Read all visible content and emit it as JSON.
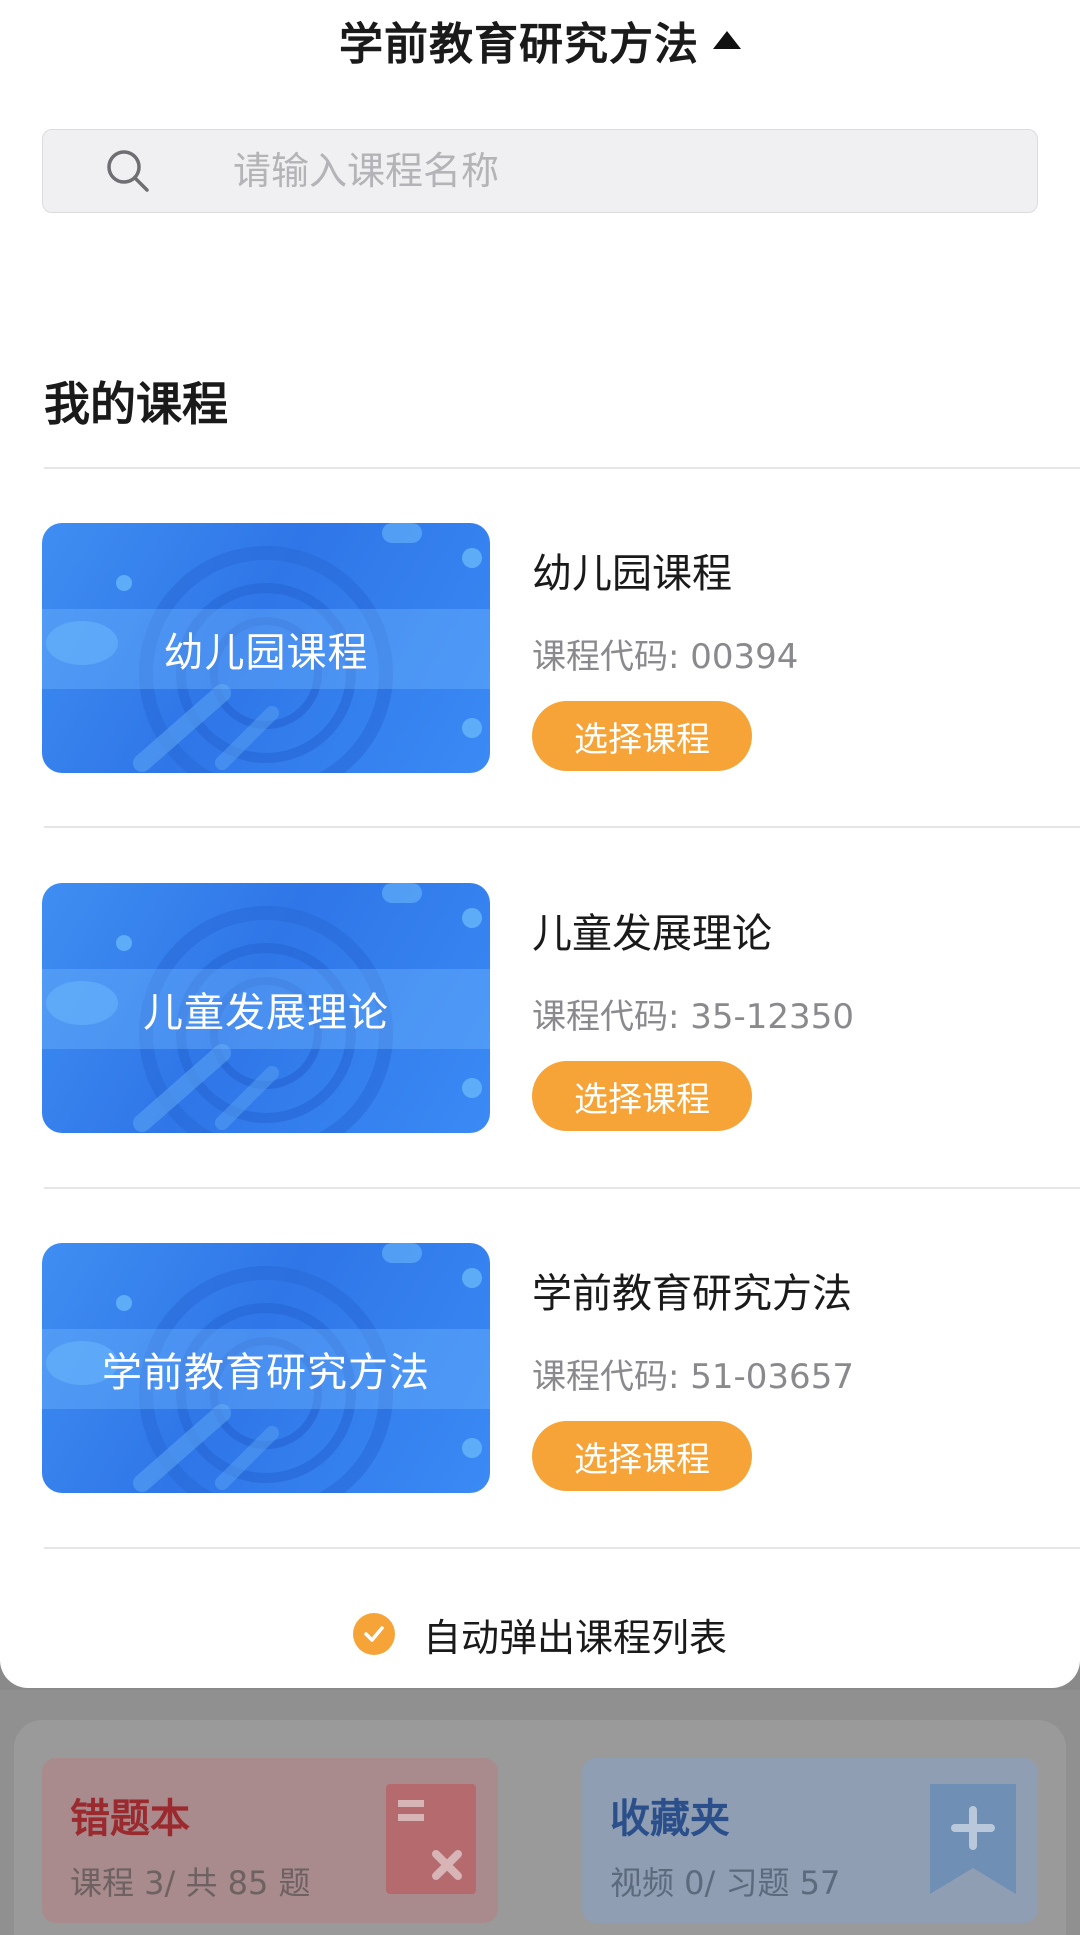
{
  "header": {
    "title": "学前教育研究方法"
  },
  "search": {
    "placeholder": "请输入课程名称",
    "value": ""
  },
  "section": {
    "title": "我的课程"
  },
  "courses": [
    {
      "thumb_label": "幼儿园课程",
      "name": "幼儿园课程",
      "code": "课程代码: 00394",
      "button": "选择课程"
    },
    {
      "thumb_label": "儿童发展理论",
      "name": "儿童发展理论",
      "code": "课程代码: 35-12350",
      "button": "选择课程"
    },
    {
      "thumb_label": "学前教育研究方法",
      "name": "学前教育研究方法",
      "code": "课程代码: 51-03657",
      "button": "选择课程"
    }
  ],
  "footer": {
    "auto_popup_label": "自动弹出课程列表",
    "auto_popup_checked": true
  },
  "background": {
    "wrong_book": {
      "title": "错题本",
      "subtitle": "课程 3/ 共 85 题"
    },
    "favorites": {
      "title": "收藏夹",
      "subtitle": "视频 0/ 习题 57"
    }
  },
  "colors": {
    "accent": "#f6a437",
    "thumb_blue": "#2f76e8"
  }
}
